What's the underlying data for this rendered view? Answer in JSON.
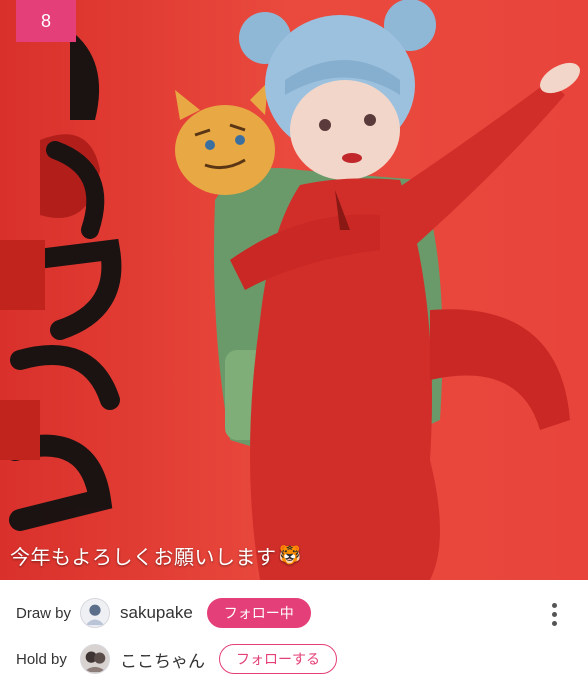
{
  "artwork": {
    "index_badge": "8",
    "caption": "今年もよろしくお願いします",
    "caption_emoji": "🐯",
    "background_color": "#e8443b"
  },
  "credits": {
    "draw": {
      "role_label": "Draw by",
      "name": "sakupake",
      "follow_label": "フォロー中",
      "follow_state": "following"
    },
    "hold": {
      "role_label": "Hold by",
      "name": "ここちゃん",
      "follow_label": "フォローする",
      "follow_state": "not-following"
    }
  },
  "colors": {
    "accent": "#e43f78",
    "text": "#333333"
  },
  "icons": {
    "more": "more-vertical-icon"
  }
}
